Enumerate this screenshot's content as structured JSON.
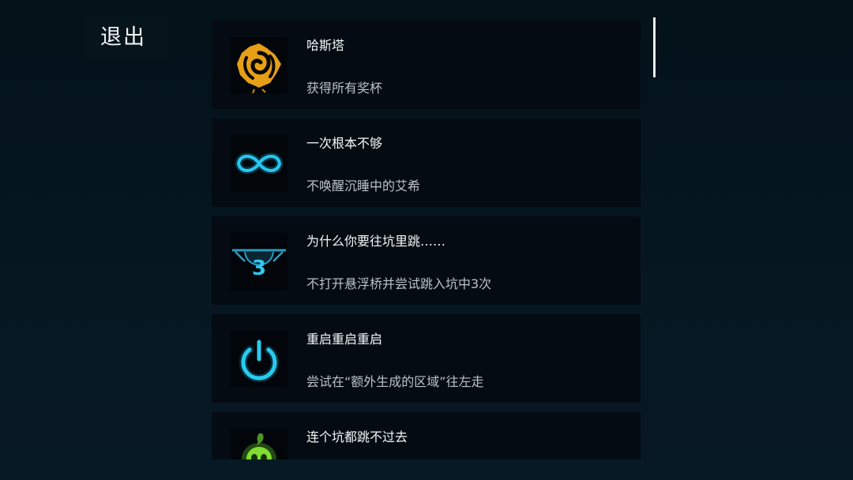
{
  "header": {
    "exit_label": "退出"
  },
  "achievements": [
    {
      "title": "哈斯塔",
      "description": "获得所有奖杯",
      "icon": "golden-spiral-icon"
    },
    {
      "title": "一次根本不够",
      "description": "不唤醒沉睡中的艾希",
      "icon": "infinity-icon"
    },
    {
      "title": "为什么你要往坑里跳……",
      "description": "不打开悬浮桥并尝试跳入坑中3次",
      "icon": "pit-three-icon",
      "badge": "3"
    },
    {
      "title": "重启重启重启",
      "description": "尝试在“额外生成的区域”往左走",
      "icon": "power-icon"
    },
    {
      "title": "连个坑都跳不过去",
      "description": "",
      "icon": "green-skull-icon"
    }
  ],
  "colors": {
    "background": "#04121a",
    "card": "#040b12",
    "accent_cyan": "#24c7ef",
    "gold": "#f2a818",
    "green": "#7edc32"
  }
}
